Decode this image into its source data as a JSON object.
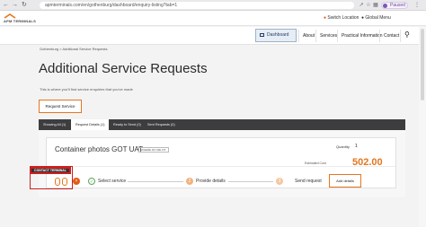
{
  "browser": {
    "url": "apmterminals.com/en/gothenburg/dashboard/enquiry-listing?tab=1",
    "profile_label": "Paused"
  },
  "topbar": {
    "logo_text": "APM TERMINALS",
    "switch_location": "Switch Location",
    "global_menu": "Global Menu"
  },
  "nav": {
    "dashboard": "Dashboard",
    "items": [
      "About",
      "Services",
      "Practical Information",
      "Contact"
    ]
  },
  "breadcrumb": "Gothenburg > Additional Service Requests",
  "page": {
    "title": "Additional Service Requests",
    "subtitle": "This is where you'll find service enquiries that you've made",
    "request_button": "Request Service"
  },
  "tabs": [
    "Showing All (1)",
    "Request Details (1)",
    "Ready to Send (0)",
    "Sent Requests (0)"
  ],
  "card": {
    "title": "Container photos GOT UAT",
    "badge": "WHERE DO WE FIT",
    "quantity_label": "Quantity",
    "quantity_value": "1",
    "cost_label": "Estimated Cost",
    "cost_value": "502.00",
    "tooltip": "CONTACT TERMINAL",
    "steps": [
      "Select service",
      "Provide details",
      "Send request"
    ],
    "step_numbers": [
      "2",
      "3"
    ],
    "add_details": "Add details"
  },
  "colors": {
    "accent": "#e3761f",
    "dark_tabs": "#3d3d3f",
    "highlight": "#cc1f1f"
  }
}
